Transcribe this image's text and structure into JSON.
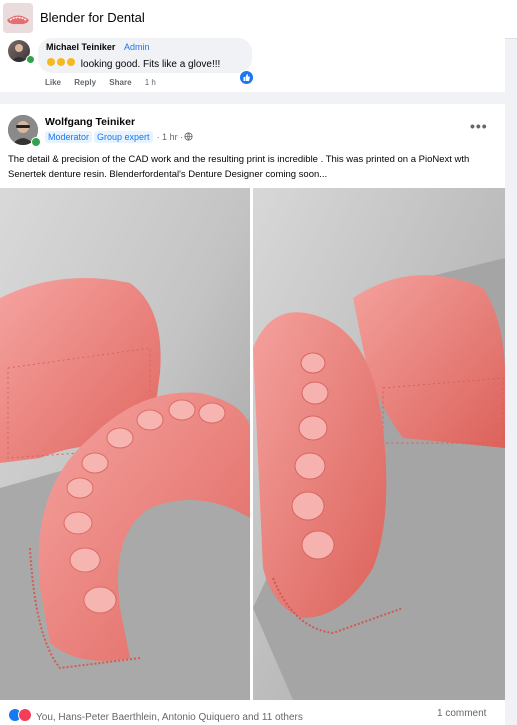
{
  "group": {
    "title": "Blender for Dental"
  },
  "comment": {
    "author": "Michael Teiniker",
    "badge": "Admin",
    "text": "looking good. Fits like a glove!!!",
    "actions": {
      "like": "Like",
      "reply": "Reply",
      "share": "Share",
      "time": "1 h"
    }
  },
  "post": {
    "author": "Wolfgang Teiniker",
    "badges": [
      "Moderator",
      "Group expert"
    ],
    "time": "· 1 hr ·",
    "more_icon": "more-icon",
    "text": "The detail & precision of the CAD work and the resulting print is incredible . This was printed on a PioNext wth Senertek denture resin. Blenderfordental's Denture Designer coming soon...",
    "reactions_text": "You, Hans-Peter Baerthlein, Antonio Quiquero and 11 others",
    "comments_text": "1 comment"
  },
  "colors": {
    "accent": "#1877f2",
    "online": "#31a24c",
    "love": "#f33e58"
  }
}
